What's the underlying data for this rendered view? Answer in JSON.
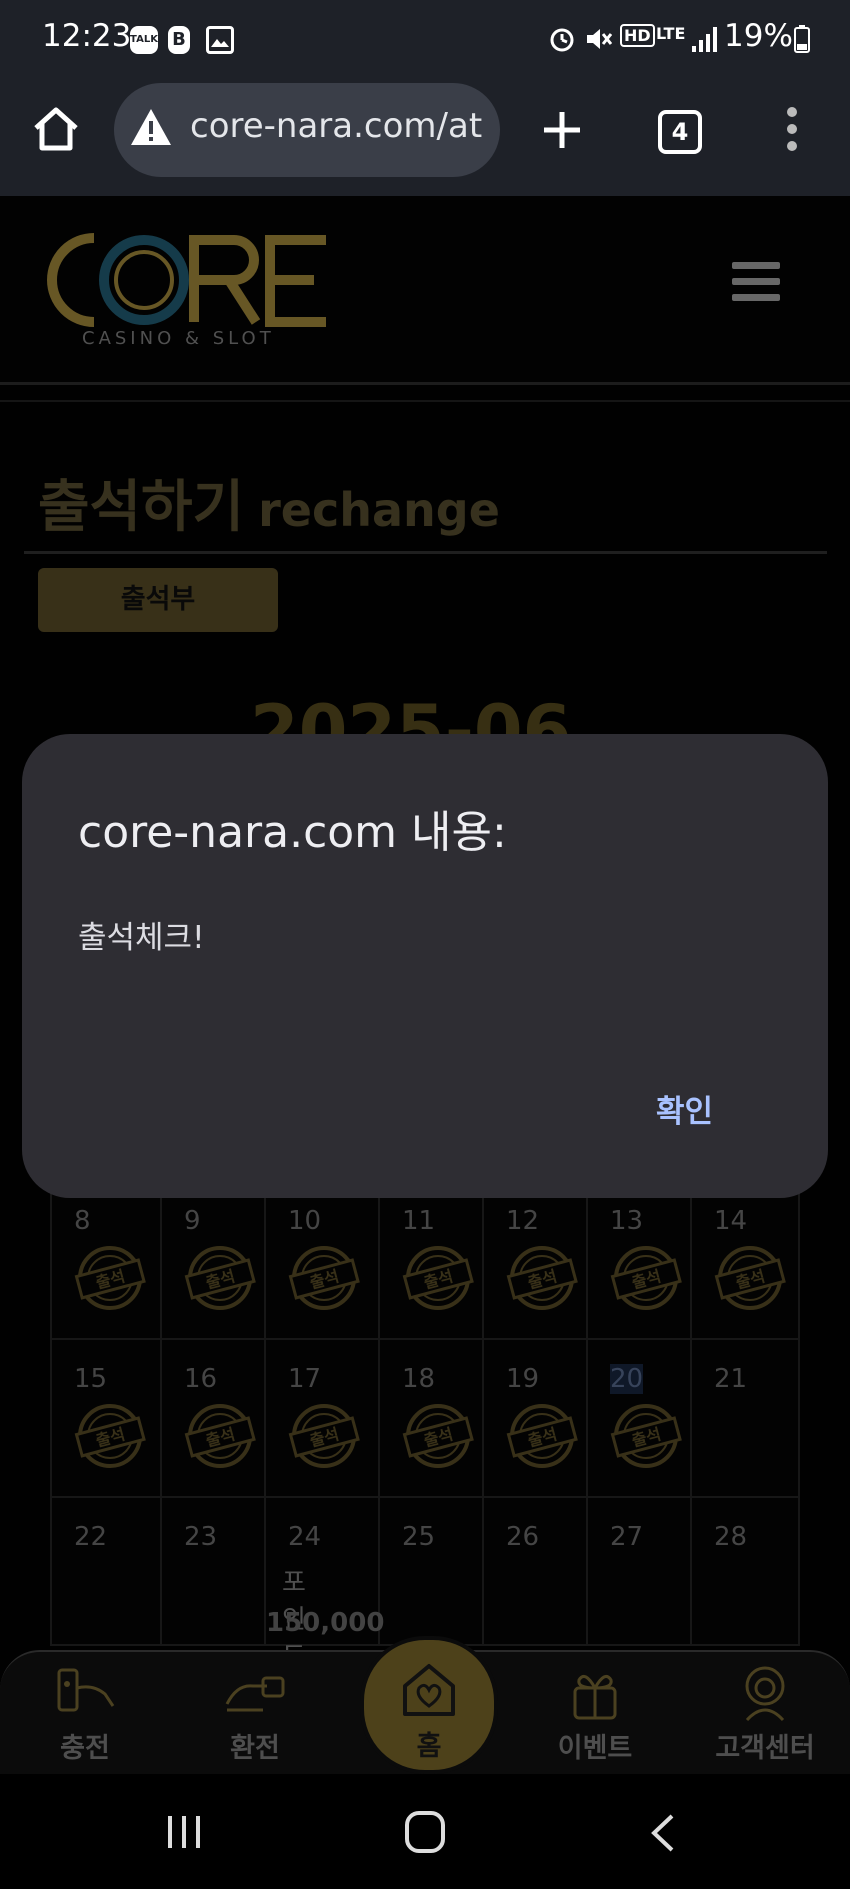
{
  "status_bar": {
    "time": "12:23",
    "left_icons": [
      "talk-icon",
      "b-icon",
      "gallery-icon"
    ],
    "right_icons": [
      "alarm-icon",
      "mute-icon",
      "hd-voice-icon",
      "lte-icon",
      "signal-icon"
    ],
    "battery": "19%",
    "hd_label": "HD",
    "lte_label": "LTE",
    "talk_label": "TALK",
    "b_label": "B"
  },
  "browser": {
    "url": "core-nara.com/at",
    "tab_count": "4"
  },
  "site": {
    "logo_text": "CORE",
    "logo_sub": "CASINO & SLOT"
  },
  "page": {
    "title": "출석하기",
    "title_sub": "rechange",
    "attend_button": "출석부",
    "year_month": "2025-06"
  },
  "calendar": {
    "weeks": [
      {
        "days": [
          {
            "d": "8",
            "stamp": true
          },
          {
            "d": "9",
            "stamp": true
          },
          {
            "d": "10",
            "stamp": true
          },
          {
            "d": "11",
            "stamp": true
          },
          {
            "d": "12",
            "stamp": true
          },
          {
            "d": "13",
            "stamp": true
          },
          {
            "d": "14",
            "stamp": true
          }
        ]
      },
      {
        "days": [
          {
            "d": "15",
            "stamp": true
          },
          {
            "d": "16",
            "stamp": true
          },
          {
            "d": "17",
            "stamp": true
          },
          {
            "d": "18",
            "stamp": true
          },
          {
            "d": "19",
            "stamp": true
          },
          {
            "d": "20",
            "stamp": true,
            "highlight": true
          },
          {
            "d": "21",
            "stamp": false
          }
        ]
      },
      {
        "days": [
          {
            "d": "22",
            "stamp": false
          },
          {
            "d": "23",
            "stamp": false
          },
          {
            "d": "24",
            "stamp": false
          },
          {
            "d": "25",
            "stamp": false
          },
          {
            "d": "26",
            "stamp": false
          },
          {
            "d": "27",
            "stamp": false
          },
          {
            "d": "28",
            "stamp": false
          }
        ]
      }
    ],
    "stamp_label": "출석",
    "point_label": "포인트",
    "point_value": "150,000"
  },
  "dialog": {
    "title": "core-nara.com 내용:",
    "message": "출석체크!",
    "ok_label": "확인"
  },
  "bottom_nav": {
    "items": [
      {
        "label": "충전",
        "icon": "deposit-icon"
      },
      {
        "label": "환전",
        "icon": "withdraw-icon"
      },
      {
        "label": "홈",
        "icon": "home-heart-icon"
      },
      {
        "label": "이벤트",
        "icon": "gift-icon"
      },
      {
        "label": "고객센터",
        "icon": "support-icon"
      }
    ]
  },
  "colors": {
    "gold": "#8a7432",
    "gold_dim": "#4b4120",
    "dialog_bg": "#2e2d33",
    "dialog_button": "#a9c2ff",
    "status_bg": "#1e2128"
  }
}
